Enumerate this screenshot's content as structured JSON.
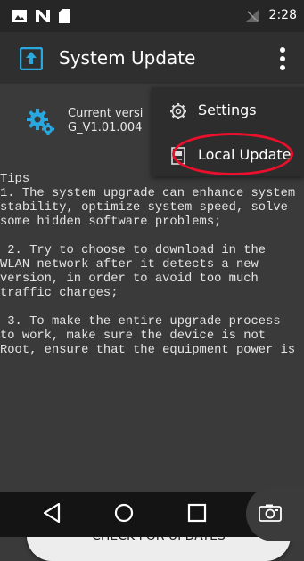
{
  "status_bar": {
    "time": "2:28",
    "icons": [
      "image-icon",
      "n-icon",
      "sd-card-icon",
      "no-signal-icon"
    ]
  },
  "app_bar": {
    "title": "System Update",
    "app_icon": "upload-box-icon",
    "overflow_icon": "more-vert-icon"
  },
  "version": {
    "line1": "Current versi",
    "line2": "G_V1.01.004",
    "icon": "gear-icon"
  },
  "tips": "Tips\n1. The system upgrade can enhance system stability, optimize system speed, solve some hidden software problems;\n\n 2. Try to choose to download in the WLAN network after it detects a new version, in order to avoid too much traffic charges;\n\n 3. To make the entire upgrade process to work, make sure the device is not Root, ensure that the equipment power is",
  "check_button": {
    "label": "CHECK FOR UPDATES"
  },
  "menu": {
    "items": [
      {
        "label": "Settings",
        "icon": "gear-outline-icon"
      },
      {
        "label": "Local Update",
        "icon": "local-file-icon"
      }
    ],
    "highlight_color": "#e8102a"
  },
  "nav_bar": {
    "buttons": [
      "back-icon",
      "home-icon",
      "recents-icon",
      "camera-icon"
    ]
  },
  "colors": {
    "background": "#3a3a3a",
    "app_bar": "#2f2f2f",
    "accent": "#29a8e0"
  }
}
